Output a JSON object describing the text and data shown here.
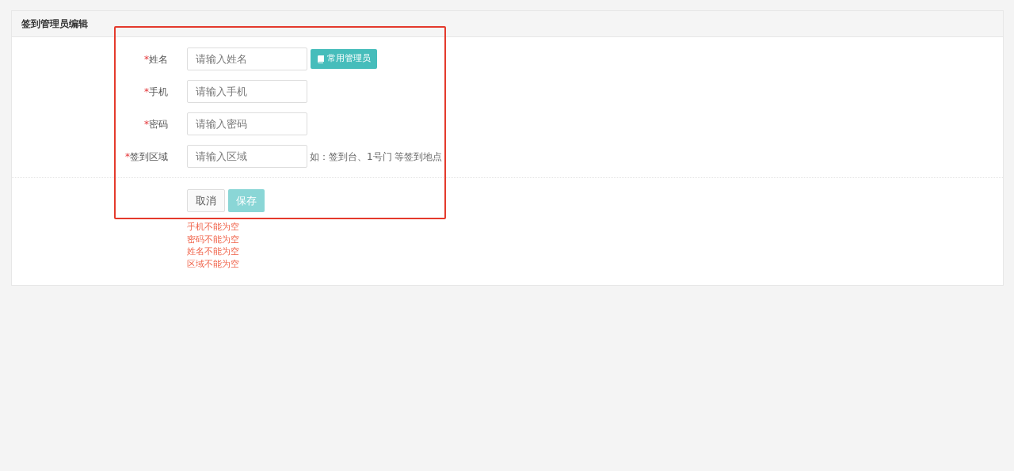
{
  "panel": {
    "title": "签到管理员编辑"
  },
  "fields": [
    {
      "label": "姓名",
      "required_mark": "*",
      "placeholder": "请输入姓名",
      "button": "常用管理员"
    },
    {
      "label": "手机",
      "required_mark": "*",
      "placeholder": "请输入手机"
    },
    {
      "label": "密码",
      "required_mark": "*",
      "placeholder": "请输入密码"
    },
    {
      "label": "签到区域",
      "required_mark": "*",
      "placeholder": "请输入区域",
      "hint": "如：签到台、1号门 等签到地点"
    }
  ],
  "buttons": [
    {
      "label": "取消",
      "kind": "cancel",
      "disabled": false
    },
    {
      "label": "保存",
      "kind": "save",
      "disabled": true
    }
  ],
  "errors": [
    "手机不能为空",
    "密码不能为空",
    "姓名不能为空",
    "区域不能为空"
  ],
  "annotation": {
    "kind": "highlight"
  }
}
